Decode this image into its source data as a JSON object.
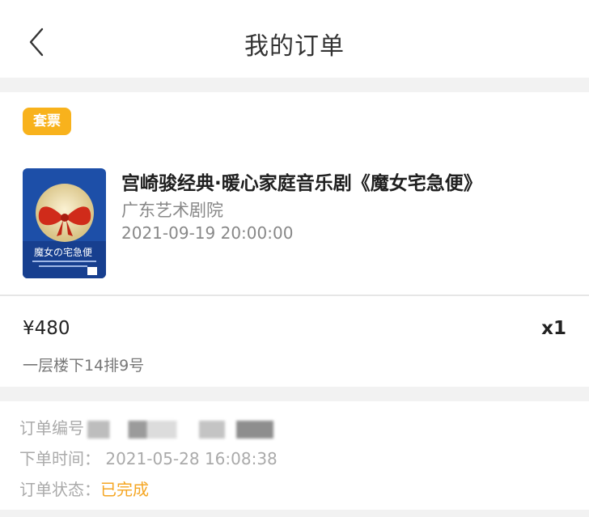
{
  "header": {
    "title": "我的订单"
  },
  "order": {
    "badge": "套票",
    "poster": {
      "icon": "poster-image",
      "colors": {
        "bg": "#1d4fa8",
        "moon": "#f3e6b8",
        "bow": "#d02b1a"
      }
    },
    "show_title": "宫崎骏经典·暖心家庭音乐剧《魔女宅急便》",
    "venue": "广东艺术剧院",
    "show_time": "2021-09-19 20:00:00",
    "price": "¥480",
    "quantity": "x1",
    "seat": "一层楼下14排9号"
  },
  "info": {
    "order_no_label": "订单编号",
    "order_time_label": "下单时间：",
    "order_time_value": "2021-05-28 16:08:38",
    "status_label": "订单状态：",
    "status_value": "已完成"
  },
  "colors": {
    "badge": "#f8b21c",
    "status_done": "#f5a623"
  }
}
